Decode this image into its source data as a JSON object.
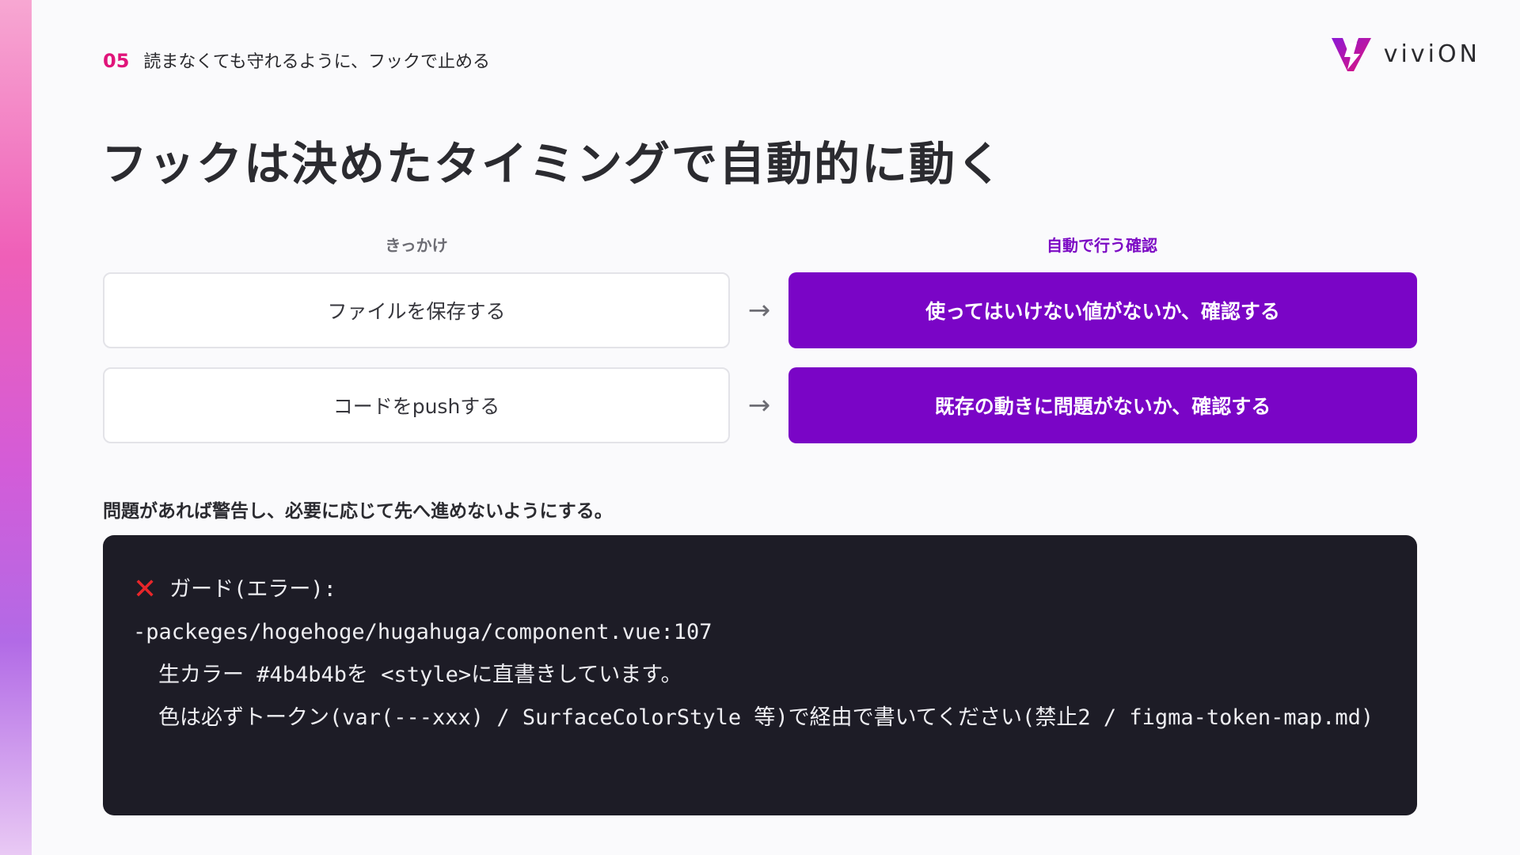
{
  "header": {
    "section_number": "05",
    "section_title": "読まなくても守れるように、フックで止める",
    "logo_text": "viviON"
  },
  "title": "フックは決めたタイミングで自動的に動く",
  "columns": {
    "left_heading": "きっかけ",
    "right_heading": "自動で行う確認"
  },
  "rows": [
    {
      "trigger": "ファイルを保存する",
      "arrow": "→",
      "action": "使ってはいけない値がないか、確認する"
    },
    {
      "trigger": "コードをpushする",
      "arrow": "→",
      "action": "既存の動きに問題がないか、確認する"
    }
  ],
  "note": "問題があれば警告し、必要に応じて先へ進めないようにする。",
  "code": {
    "icon": "cross-mark-icon",
    "icon_glyph": "✕",
    "error_label": "ガード(エラー):",
    "path_line": "-packeges/hogehoge/hugahuga/component.vue:107",
    "message_line1": "生カラー #4b4b4bを <style>に直書きしています。",
    "message_line2": "色は必ずトークン(var(---xxx) / SurfaceColorStyle 等)で経由で書いてください(禁止2 / figma-token-map.md)"
  },
  "colors": {
    "accent_pink": "#e0147a",
    "action_purple": "#7a05c6",
    "code_bg": "#1d1c26",
    "error_red": "#e8262a"
  }
}
